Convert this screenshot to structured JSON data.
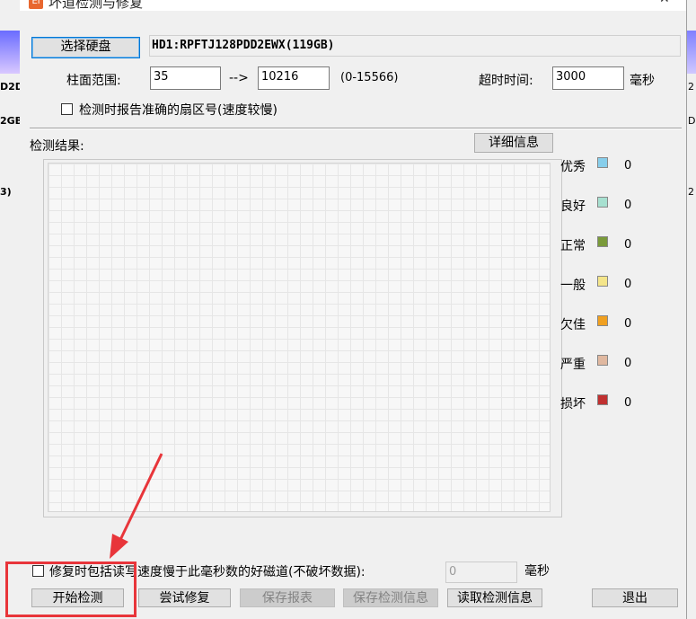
{
  "background": {
    "left_fragments": [
      "D2D",
      "2GB",
      "3)"
    ],
    "right_fragments": [
      "2",
      "D",
      "2"
    ]
  },
  "window": {
    "title": "坏道检测与修复",
    "app_icon": "Ei",
    "minimize": "—",
    "close": "✕"
  },
  "disk": {
    "select_button": "选择硬盘",
    "value": "HD1:RPFTJ128PDD2EWX(119GB)"
  },
  "cylinder": {
    "label": "柱面范围:",
    "from": "35",
    "arrow": "-->",
    "to": "10216",
    "range_hint": "(0-15566)"
  },
  "timeout": {
    "label": "超时时间:",
    "value": "3000",
    "unit": "毫秒"
  },
  "report_sector": {
    "label": "检测时报告准确的扇区号(速度较慢)",
    "checked": false
  },
  "results": {
    "label": "检测结果:",
    "details_button": "详细信息"
  },
  "legend": [
    {
      "label": "优秀",
      "color": "#87ceeb",
      "count": "0"
    },
    {
      "label": "良好",
      "color": "#a7e0d0",
      "count": "0"
    },
    {
      "label": "正常",
      "color": "#7a9a3a",
      "count": "0"
    },
    {
      "label": "一般",
      "color": "#f4e58a",
      "count": "0"
    },
    {
      "label": "欠佳",
      "color": "#f0a020",
      "count": "0"
    },
    {
      "label": "严重",
      "color": "#e0b8a0",
      "count": "0"
    },
    {
      "label": "损坏",
      "color": "#c03030",
      "count": "0"
    }
  ],
  "repair_option": {
    "label": "修复时包括读写速度慢于此毫秒数的好磁道(不破坏数据):",
    "value": "0",
    "unit": "毫秒",
    "checked": false
  },
  "actions": {
    "start": "开始检测",
    "try_repair": "尝试修复",
    "save_report": "保存报表",
    "save_info": "保存检测信息",
    "read_info": "读取检测信息",
    "exit": "退出"
  },
  "colors": {
    "annotation": "#e8353a",
    "focus_border": "#0078d7"
  }
}
